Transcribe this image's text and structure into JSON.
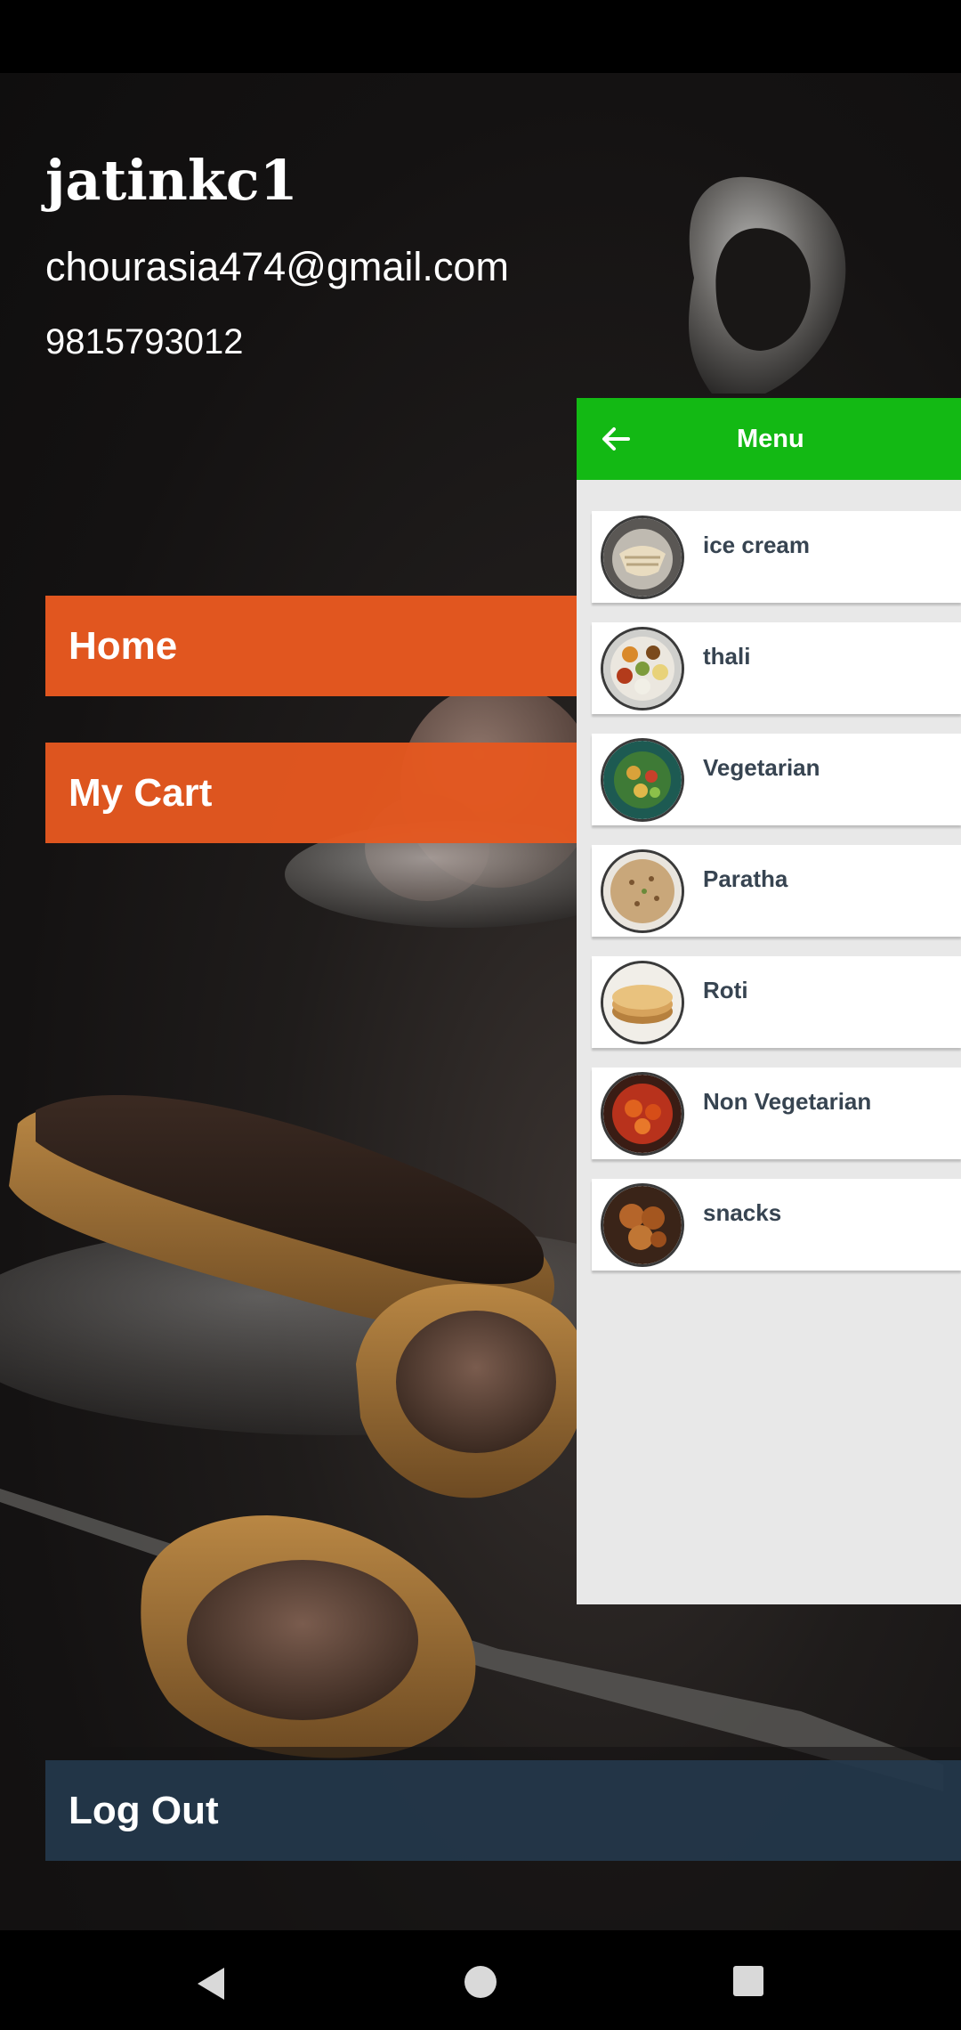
{
  "profile": {
    "name": "jatinkc1",
    "email": "chourasia474@gmail.com",
    "phone": "9815793012"
  },
  "drawer": {
    "home_label": "Home",
    "cart_label": "My Cart",
    "logout_label": "Log Out"
  },
  "menu": {
    "title": "Menu",
    "back_icon": "arrow-left-icon",
    "items": [
      {
        "label": "ice cream",
        "icon": "ice-cream-thumbnail"
      },
      {
        "label": "thali",
        "icon": "thali-thumbnail"
      },
      {
        "label": "Vegetarian",
        "icon": "vegetarian-thumbnail"
      },
      {
        "label": "Paratha",
        "icon": "paratha-thumbnail"
      },
      {
        "label": "Roti",
        "icon": "roti-thumbnail"
      },
      {
        "label": "Non Vegetarian",
        "icon": "non-vegetarian-thumbnail"
      },
      {
        "label": "snacks",
        "icon": "snacks-thumbnail"
      }
    ]
  },
  "navigation": {
    "back_icon": "nav-back-icon",
    "home_icon": "nav-home-icon",
    "recents_icon": "nav-recents-icon"
  },
  "colors": {
    "accent_orange": "#e1561f",
    "toolbar_green": "#13b914",
    "logout_blue": "#243a4e",
    "panel_gray": "#e8e8e8",
    "item_text": "#374451"
  }
}
